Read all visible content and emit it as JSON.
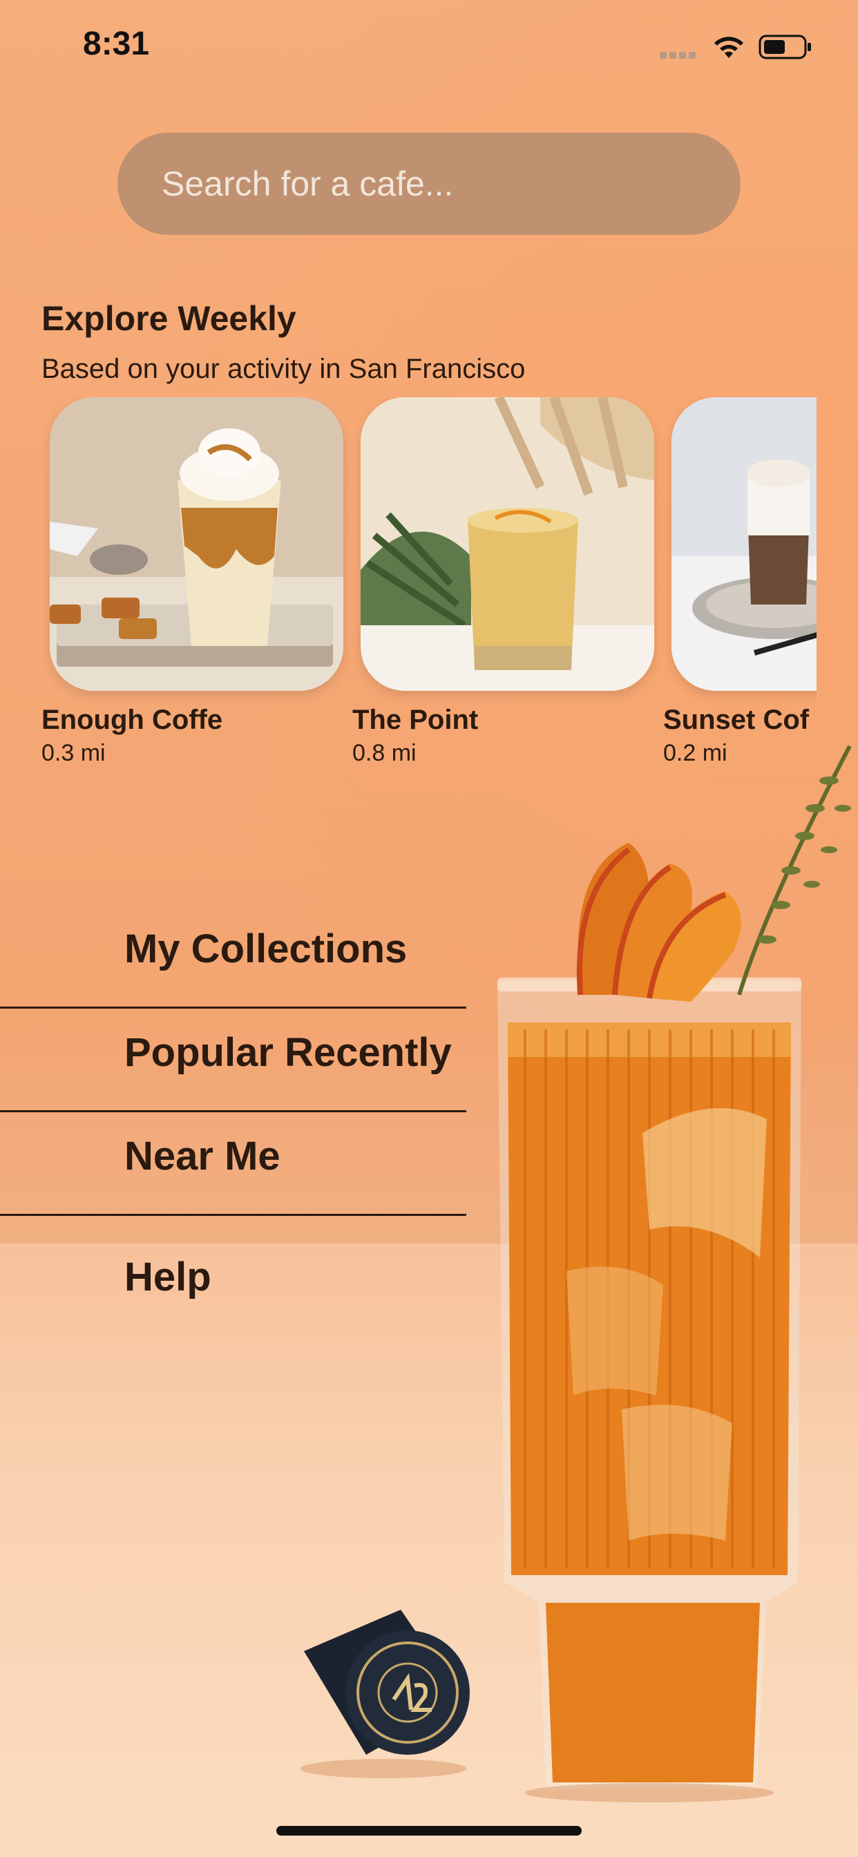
{
  "status_bar": {
    "time": "8:31"
  },
  "search": {
    "placeholder": "Search for a cafe..."
  },
  "explore": {
    "title": "Explore Weekly",
    "subtitle": "Based on your activity in San Francisco",
    "cards": [
      {
        "name": "Enough Coffe",
        "distance": "0.3 mi"
      },
      {
        "name": "The Point",
        "distance": "0.8 mi"
      },
      {
        "name": "Sunset Cof",
        "distance": "0.2 mi"
      }
    ]
  },
  "menu": {
    "items": [
      {
        "label": "My Collections"
      },
      {
        "label": "Popular Recently"
      },
      {
        "label": "Near Me"
      },
      {
        "label": "Help"
      }
    ]
  },
  "colors": {
    "background": "#f6ad7a",
    "search_bg": "#bf9170",
    "text": "#2a1a10",
    "drink": "#e8801f"
  },
  "icons": [
    "signal-icon",
    "wifi-icon",
    "battery-icon"
  ]
}
